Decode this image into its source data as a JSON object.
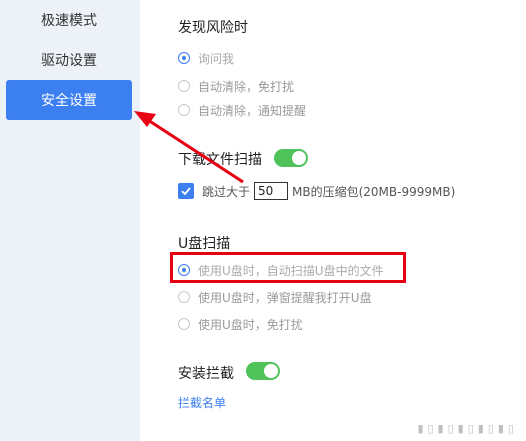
{
  "sidebar": {
    "items": [
      {
        "label": "极速模式"
      },
      {
        "label": "驱动设置"
      },
      {
        "label": "安全设置",
        "active": true
      }
    ]
  },
  "risk": {
    "title": "发现风险时",
    "options": [
      {
        "label": "询问我",
        "checked": true
      },
      {
        "label": "自动清除，免打扰",
        "checked": false
      },
      {
        "label": "自动清除，通知提醒",
        "checked": false
      }
    ]
  },
  "download_scan": {
    "title": "下载文件扫描",
    "toggle_on": true,
    "skip_prefix": "跳过大于",
    "skip_value": "50",
    "skip_suffix": "MB的压缩包(20MB-9999MB)",
    "skip_checked": true
  },
  "usb_scan": {
    "title": "U盘扫描",
    "options": [
      {
        "label": "使用U盘时，自动扫描U盘中的文件",
        "checked": true
      },
      {
        "label": "使用U盘时，弹窗提醒我打开U盘",
        "checked": false
      },
      {
        "label": "使用U盘时，免打扰",
        "checked": false
      }
    ]
  },
  "install_block": {
    "title": "安装拦截",
    "toggle_on": true,
    "link_label": "拦截名单"
  },
  "colors": {
    "accent": "#3b7ff0",
    "toggle_on": "#4fc25a",
    "annotation_red": "#e60012"
  }
}
